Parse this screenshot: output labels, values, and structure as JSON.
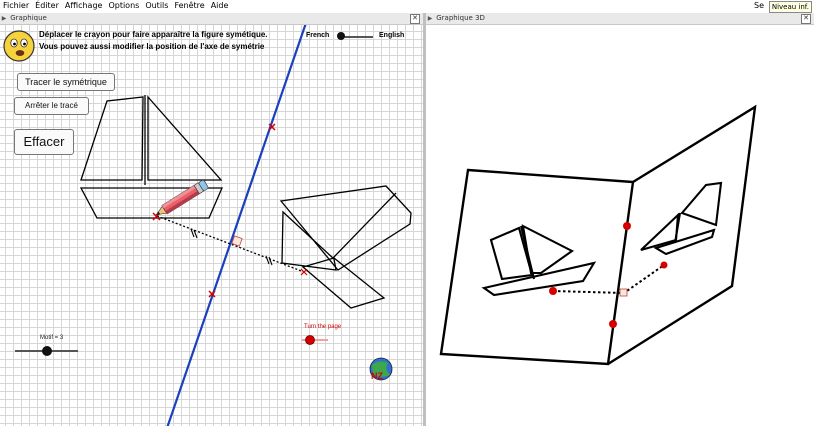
{
  "menu": {
    "items": [
      "Fichier",
      "Éditer",
      "Affichage",
      "Options",
      "Outils",
      "Fenêtre",
      "Aide"
    ],
    "right_text": "Se",
    "tooltip": "Niveau inf."
  },
  "left_panel": {
    "title": "Graphique",
    "instruction_line1": "Déplacer le crayon pour faire apparaître la figure symétique.",
    "instruction_line2": "Vous pouvez aussi modifier la position de l'axe de symétrie",
    "lang_french": "French",
    "lang_english": "English",
    "buttons": {
      "trace": "Tracer le symétrique",
      "stop": "Arrêter le tracé",
      "clear": "Effacer"
    },
    "motif_label": "Motif = 3",
    "turn_page_label": "Turn the page"
  },
  "right_panel": {
    "title": "Graphique 3D"
  },
  "colors": {
    "axis": "#1a3fbf",
    "point_red": "#d40000",
    "panel_title_bg": "#e9e9e9"
  }
}
